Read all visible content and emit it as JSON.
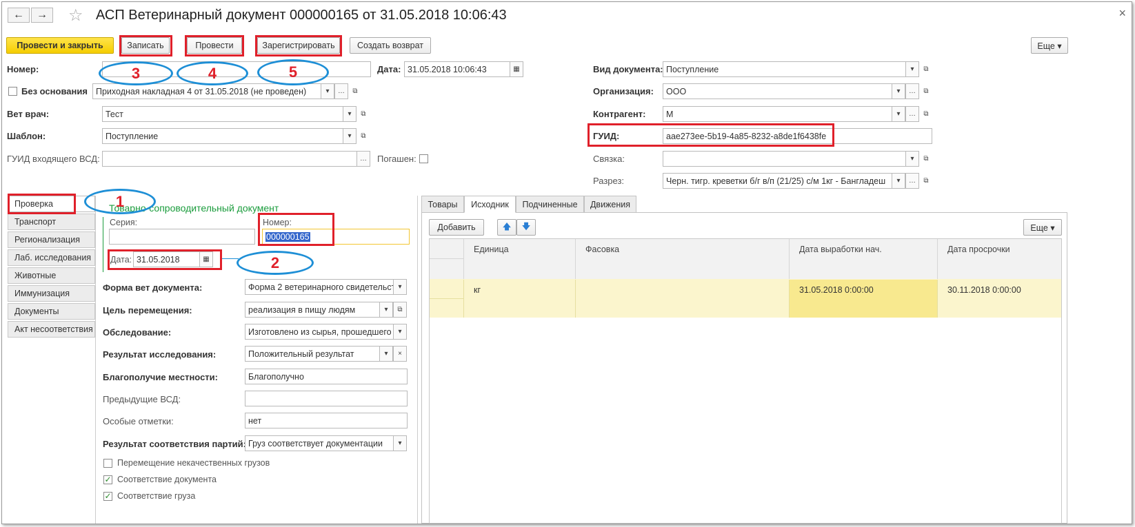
{
  "window": {
    "title": "АСП Ветеринарный документ 000000165 от 31.05.2018 10:06:43",
    "back_icon": "←",
    "forward_icon": "→",
    "star_icon": "☆",
    "close_icon": "×"
  },
  "toolbar": {
    "post_close": "Провести и закрыть",
    "save": "Записать",
    "post": "Провести",
    "register": "Зарегистрировать",
    "create_return": "Создать возврат",
    "more": "Еще ▾"
  },
  "header": {
    "number_label": "Номер:",
    "date_label": "Дата:",
    "date_value": "31.05.2018 10:06:43",
    "no_basis_label": "Без основания",
    "basis_value": "Приходная накладная 4 от 31.05.2018 (не проведен)",
    "vet_label": "Вет врач:",
    "vet_value": "Тест",
    "template_label": "Шаблон:",
    "template_value": "Поступление",
    "guid_in_label": "ГУИД входящего ВСД:",
    "guid_in_value": "",
    "paid_label": "Погашен:",
    "doctype_label": "Вид документа:",
    "doctype_value": "Поступление",
    "org_label": "Организация:",
    "org_value": "ООО",
    "contractor_label": "Контрагент:",
    "contractor_value": "М",
    "guid_label": "ГУИД:",
    "guid_value": "aae273ee-5b19-4a85-8232-a8de1f6438fe",
    "link_label": "Связка:",
    "link_value": "",
    "section_label": "Разрез:",
    "section_value": "Черн. тигр. креветки б/г в/п (21/25) с/м 1кг - Бангладеш"
  },
  "sidetabs": [
    "Проверка",
    "Транспорт",
    "Регионализация",
    "Лаб. исследования",
    "Животные",
    "Иммунизация",
    "Документы",
    "Акт несоответствия"
  ],
  "check": {
    "group_title": "Товарно-сопроводительный документ",
    "series_label": "Серия:",
    "series_value": "",
    "number_label": "Номер:",
    "number_value": "000000165",
    "date_label": "Дата:",
    "date_value": "31.05.2018",
    "form_label": "Форма вет документа:",
    "form_value": "Форма 2 ветеринарного свидетельст",
    "purpose_label": "Цель перемещения:",
    "purpose_value": "реализация в пищу людям",
    "exam_label": "Обследование:",
    "exam_value": "Изготовлено из сырья, прошедшего",
    "result_label": "Результат исследования:",
    "result_value": "Положительный результат",
    "welfare_label": "Благополучие местности:",
    "welfare_value": "Благополучно",
    "prev_label": "Предыдущие ВСД:",
    "prev_value": "",
    "notes_label": "Особые отметки:",
    "notes_value": "нет",
    "match_label": "Результат соответствия партий:",
    "match_value": "Груз соответствует документации",
    "cb_bad_cargo": "Перемещение некачественных грузов",
    "cb_doc_match": "Соответствие документа",
    "cb_cargo_match": "Соответствие груза"
  },
  "tabs": [
    "Товары",
    "Исходник",
    "Подчиненные",
    "Движения"
  ],
  "table": {
    "add": "Добавить",
    "more": "Еще ▾",
    "columns": [
      "Единица",
      "Фасовка",
      "Дата выработки нач.",
      "Дата просрочки"
    ],
    "rows": [
      [
        "кг",
        "",
        "31.05.2018 0:00:00",
        "30.11.2018 0:00:00"
      ]
    ]
  },
  "annotations": [
    "1",
    "2",
    "3",
    "4",
    "5"
  ]
}
